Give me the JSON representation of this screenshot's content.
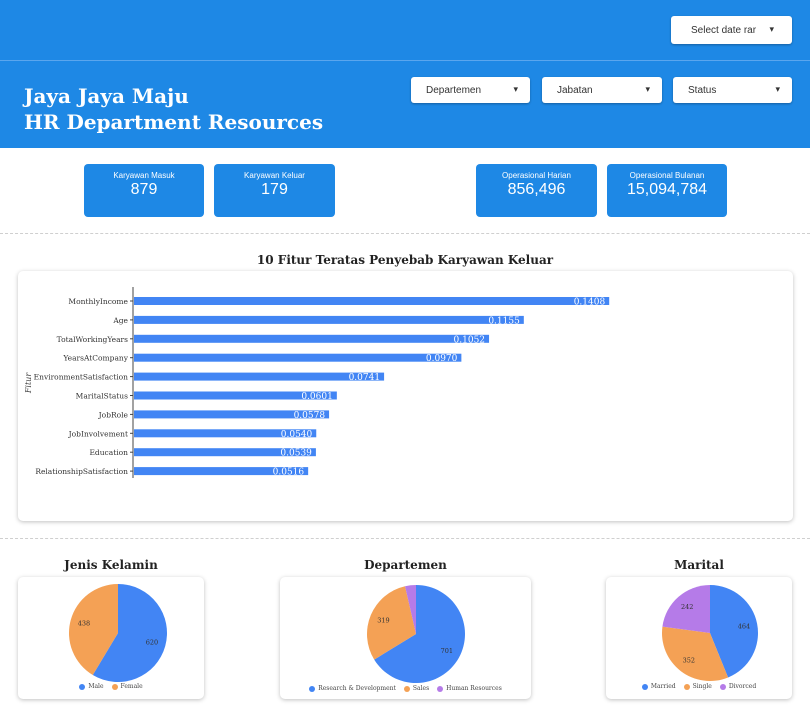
{
  "topbar": {
    "date_button": "Select date rar"
  },
  "header": {
    "title_line1": "Jaya Jaya Maju",
    "title_line2": "HR Department Resources",
    "filters": [
      {
        "label": "Departemen"
      },
      {
        "label": "Jabatan"
      },
      {
        "label": "Status"
      }
    ]
  },
  "kpis": [
    {
      "label": "Karyawan Masuk",
      "value": "879"
    },
    {
      "label": "Karyawan Keluar",
      "value": "179"
    },
    {
      "label": "Operasional Harian",
      "value": "856,496"
    },
    {
      "label": "Operasional Bulanan",
      "value": "15,094,784"
    }
  ],
  "colors": {
    "primary": "#1e88e5",
    "bar": "#4285f4",
    "orange": "#f4a155",
    "purple": "#b57be8"
  },
  "chart_data": [
    {
      "type": "bar",
      "orientation": "horizontal",
      "title": "10 Fitur Teratas Penyebab Karyawan Keluar",
      "ylabel": "Fitur",
      "categories": [
        "MonthlyIncome",
        "Age",
        "TotalWorkingYears",
        "YearsAtCompany",
        "EnvironmentSatisfaction",
        "MaritalStatus",
        "JobRole",
        "JobInvolvement",
        "Education",
        "RelationshipSatisfaction"
      ],
      "values": [
        0.1408,
        0.1155,
        0.1052,
        0.097,
        0.0741,
        0.0601,
        0.0578,
        0.054,
        0.0539,
        0.0516
      ],
      "value_labels": [
        "0.1408",
        "0.1155",
        "0.1052",
        "0.0970",
        "0.0741",
        "0.0601",
        "0.0578",
        "0.0540",
        "0.0539",
        "0.0516"
      ],
      "xlim": [
        0,
        0.16
      ]
    },
    {
      "type": "pie",
      "title": "Jenis Kelamin",
      "labels": [
        "Male",
        "Female"
      ],
      "values": [
        620,
        438
      ],
      "colors": [
        "#4285f4",
        "#f4a155"
      ],
      "legend": "bottom"
    },
    {
      "type": "pie",
      "title": "Departemen",
      "labels": [
        "Research & Development",
        "Sales",
        "Human Resources"
      ],
      "values": [
        701,
        319,
        38
      ],
      "value_labels": [
        "701",
        "319",
        ""
      ],
      "colors": [
        "#4285f4",
        "#f4a155",
        "#b57be8"
      ],
      "legend": "bottom"
    },
    {
      "type": "pie",
      "title": "Marital",
      "labels": [
        "Married",
        "Single",
        "Divorced"
      ],
      "values": [
        464,
        352,
        242
      ],
      "colors": [
        "#4285f4",
        "#f4a155",
        "#b57be8"
      ],
      "legend": "bottom"
    }
  ]
}
